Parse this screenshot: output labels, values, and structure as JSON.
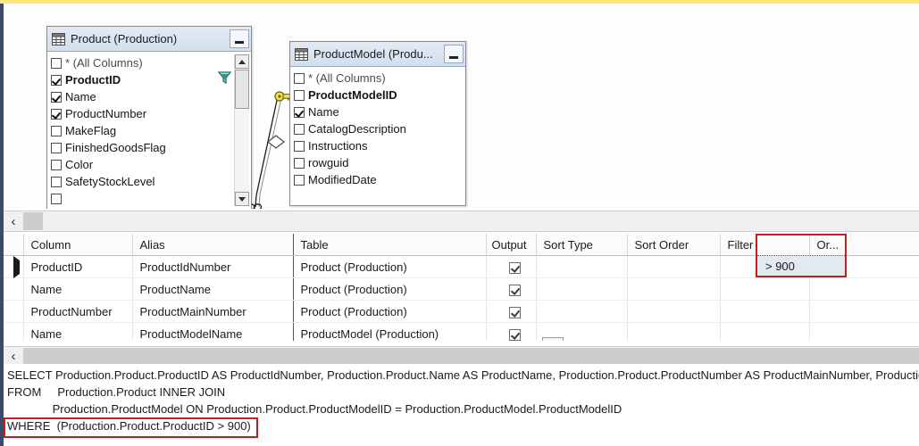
{
  "window": {
    "accent_top_color": "#fde47f",
    "accent_left_color": "#3b4a6b"
  },
  "diagram": {
    "tables": [
      {
        "title": "Product (Production)",
        "icon": "table-grid-icon",
        "minimize_label": "Minimize",
        "columns": [
          {
            "name": "* (All Columns)",
            "checked": false,
            "bold": false,
            "dim": true
          },
          {
            "name": "ProductID",
            "checked": true,
            "bold": true,
            "dim": false
          },
          {
            "name": "Name",
            "checked": true,
            "bold": false,
            "dim": false
          },
          {
            "name": "ProductNumber",
            "checked": true,
            "bold": false,
            "dim": false
          },
          {
            "name": "MakeFlag",
            "checked": false,
            "bold": false,
            "dim": false
          },
          {
            "name": "FinishedGoodsFlag",
            "checked": false,
            "bold": false,
            "dim": false
          },
          {
            "name": "Color",
            "checked": false,
            "bold": false,
            "dim": false
          },
          {
            "name": "SafetyStockLevel",
            "checked": false,
            "bold": false,
            "dim": false
          }
        ],
        "has_filter_icon": true,
        "filter_icon_name": "funnel-filter-icon",
        "has_scrollbar": true
      },
      {
        "title": "ProductModel (Produ...",
        "icon": "table-grid-icon",
        "minimize_label": "Minimize",
        "columns": [
          {
            "name": "* (All Columns)",
            "checked": false,
            "bold": false,
            "dim": true
          },
          {
            "name": "ProductModelID",
            "checked": false,
            "bold": true,
            "dim": false
          },
          {
            "name": "Name",
            "checked": true,
            "bold": false,
            "dim": false
          },
          {
            "name": "CatalogDescription",
            "checked": false,
            "bold": false,
            "dim": false
          },
          {
            "name": "Instructions",
            "checked": false,
            "bold": false,
            "dim": false
          },
          {
            "name": "rowguid",
            "checked": false,
            "bold": false,
            "dim": false
          },
          {
            "name": "ModifiedDate",
            "checked": false,
            "bold": false,
            "dim": false
          }
        ],
        "has_filter_icon": false,
        "has_scrollbar": false
      }
    ],
    "join": {
      "type": "inner-join",
      "left_end_symbol": "many",
      "right_end_symbol": "key",
      "middle_symbol": "diamond"
    }
  },
  "scrollbars": {
    "diagram_scroll_left_arrow": "‹",
    "grid_scroll_left_arrow": "‹"
  },
  "grid": {
    "headers": [
      "Column",
      "Alias",
      "Table",
      "Output",
      "Sort Type",
      "Sort Order",
      "Filter",
      "Or..."
    ],
    "rows": [
      {
        "selected": true,
        "column": "ProductID",
        "alias": "ProductIdNumber",
        "table": "Product (Production)",
        "output": true,
        "sort_type": "",
        "sort_order": "",
        "filter": "> 900",
        "or": ""
      },
      {
        "selected": false,
        "column": "Name",
        "alias": "ProductName",
        "table": "Product (Production)",
        "output": true,
        "sort_type": "",
        "sort_order": "",
        "filter": "",
        "or": ""
      },
      {
        "selected": false,
        "column": "ProductNumber",
        "alias": "ProductMainNumber",
        "table": "Product (Production)",
        "output": true,
        "sort_type": "",
        "sort_order": "",
        "filter": "",
        "or": ""
      },
      {
        "selected": false,
        "column": "Name",
        "alias": "ProductModelName",
        "table": "ProductModel (Production)",
        "output": true,
        "sort_type": "",
        "sort_order": "",
        "filter": "",
        "or": ""
      }
    ],
    "highlight_color": "#c0201e",
    "highlighted_column": "Filter"
  },
  "sql": {
    "lines": [
      "SELECT Production.Product.ProductID AS ProductIdNumber, Production.Product.Name AS ProductName, Production.Product.ProductNumber AS ProductMainNumber, Production",
      "FROM     Production.Product INNER JOIN",
      "              Production.ProductModel ON Production.Product.ProductModelID = Production.ProductModel.ProductModelID",
      "WHERE  (Production.Product.ProductID > 900)"
    ],
    "highlighted_line_index": 3,
    "highlight_color": "#c0201e"
  }
}
